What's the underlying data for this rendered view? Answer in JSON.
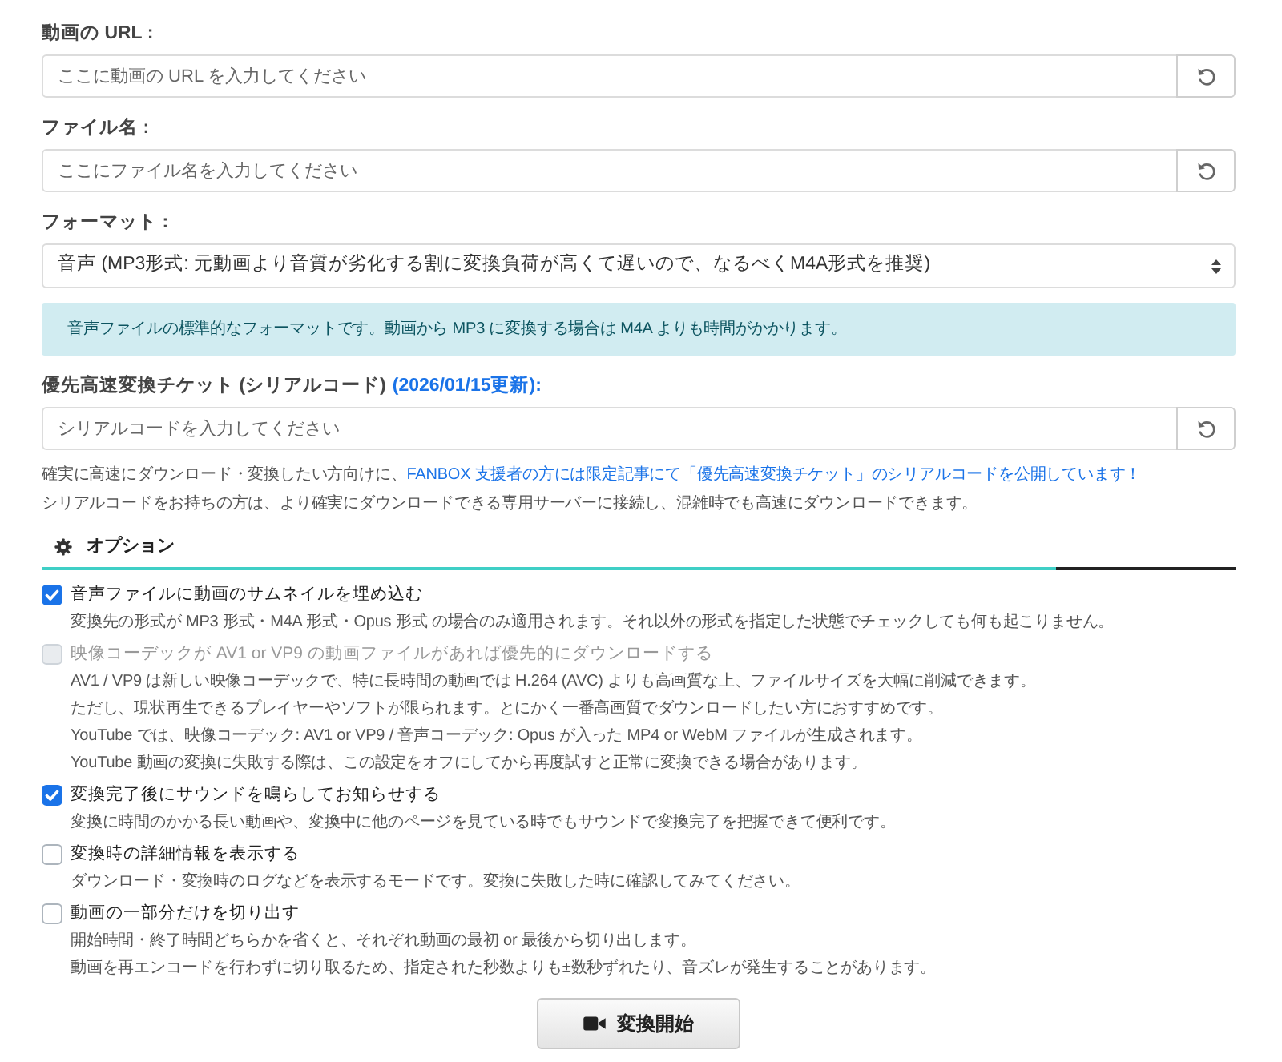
{
  "fields": [
    {
      "kind": "input",
      "label": "動画の URL :",
      "placeholder": "ここに動画の URL を入力してください"
    },
    {
      "kind": "input",
      "label": "ファイル名 :",
      "placeholder": "ここにファイル名を入力してください"
    },
    {
      "kind": "select",
      "label": "フォーマット :",
      "value": "音声 (MP3形式: 元動画より音質が劣化する割に変換負荷が高くて遅いので、なるべくM4A形式を推奨)",
      "note": "音声ファイルの標準的なフォーマットです。動画から MP3 に変換する場合は M4A よりも時間がかかります。"
    },
    {
      "kind": "input",
      "label": "優先高速変換チケット (シリアルコード)",
      "label_link": "(2026/01/15更新):",
      "placeholder": "シリアルコードを入力してください",
      "help": {
        "text": "確実に高速にダウンロード・変換したい方向けに、",
        "link": "FANBOX 支援者の方には限定記事にて「優先高速変換チケット」のシリアルコードを公開しています！",
        "text_after": "シリアルコードをお持ちの方は、より確実にダウンロードできる専用サーバーに接続し、混雑時でも高速にダウンロードできます。"
      }
    }
  ],
  "options": {
    "title": "オプション",
    "progress": {
      "level": 0.85
    },
    "items": [
      {
        "label": "音声ファイルに動画のサムネイルを埋め込む",
        "checked": true,
        "disabled": false,
        "description": [
          "変換先の形式が MP3 形式・M4A 形式・Opus 形式 の場合のみ適用されます。それ以外の形式を指定した状態でチェックしても何も起こりません。"
        ]
      },
      {
        "label": "映像コーデックが AV1 or VP9 の動画ファイルがあれば優先的にダウンロードする",
        "checked": false,
        "disabled": true,
        "description": [
          "AV1 / VP9 は新しい映像コーデックで、特に長時間の動画では H.264 (AVC) よりも高画質な上、ファイルサイズを大幅に削減できます。",
          "ただし、現状再生できるプレイヤーやソフトが限られます。とにかく一番高画質でダウンロードしたい方におすすめです。",
          "YouTube では、映像コーデック: AV1 or VP9 / 音声コーデック: Opus が入った MP4 or WebM ファイルが生成されます。",
          "YouTube 動画の変換に失敗する際は、この設定をオフにしてから再度試すと正常に変換できる場合があります。"
        ]
      },
      {
        "label": "変換完了後にサウンドを鳴らしてお知らせする",
        "checked": true,
        "disabled": false,
        "description": [
          "変換に時間のかかる長い動画や、変換中に他のページを見ている時でもサウンドで変換完了を把握できて便利です。"
        ]
      },
      {
        "label": "変換時の詳細情報を表示する",
        "checked": false,
        "disabled": false,
        "description": [
          "ダウンロード・変換時のログなどを表示するモードです。変換に失敗した時に確認してみてください。"
        ]
      },
      {
        "label": "動画の一部分だけを切り出す",
        "checked": false,
        "disabled": false,
        "description": [
          "開始時間・終了時間どちらかを省くと、それぞれ動画の最初 or 最後から切り出します。",
          "動画を再エンコードを行わずに切り取るため、指定された秒数よりも±数秒ずれたり、音ズレが発生することがあります。"
        ]
      }
    ]
  },
  "submit": {
    "label": "変換開始"
  }
}
